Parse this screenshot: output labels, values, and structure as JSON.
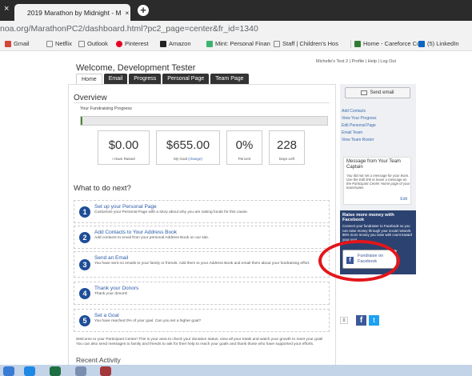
{
  "browser": {
    "tab_close_left": "×",
    "tab_title": "2019 Marathon by Midnight - M  ×",
    "tab_close": "",
    "new_tab": "+",
    "url": "noa.org/MarathonPC2/dashboard.html?pc2_page=center&fr_id=1340",
    "bookmarks": [
      {
        "label": "Gmail",
        "icon_color": "#d44638"
      },
      {
        "label": "Netflix",
        "icon_color": "#888888"
      },
      {
        "label": "Outlook",
        "icon_color": "#888888"
      },
      {
        "label": "Pinterest",
        "icon_color": "#e60023"
      },
      {
        "label": "Amazon",
        "icon_color": "#222222"
      },
      {
        "label": "Mint: Personal Finan",
        "icon_color": "#3cb371"
      },
      {
        "label": "Staff | Children's Hos",
        "icon_color": "#888888"
      },
      {
        "label": "Home - Careforce Co",
        "icon_color": "#2e7d32"
      },
      {
        "label": "(5) LinkedIn",
        "icon_color": "#0a66c2"
      }
    ]
  },
  "page": {
    "welcome": "Welcome, Development Tester",
    "top_links": "Michelle's Test 2  |  Profile  |  Help  |  Log Out",
    "tabs": [
      "Home",
      "Email",
      "Progress",
      "Personal Page",
      "Team Page"
    ],
    "overview_title": "Overview",
    "progress_label": "Your Fundraising Progress",
    "progress_fraction": 0,
    "stats": [
      {
        "value": "$0.00",
        "label": "I Have Raised",
        "link": ""
      },
      {
        "value": "$655.00",
        "label": "My Goal ",
        "link": "(change)"
      },
      {
        "value": "0%",
        "label": "Percent",
        "link": ""
      },
      {
        "value": "228",
        "label": "Days Left",
        "link": ""
      }
    ],
    "next_title": "What to do next?",
    "steps": [
      {
        "num": "1",
        "title": "Set up your Personal Page",
        "desc": "Customize your Personal Page with a story about why you are raising funds for this cause."
      },
      {
        "num": "2",
        "title": "Add Contacts to Your Address Book",
        "desc": "Add contacts to email from your personal Address Book on our site."
      },
      {
        "num": "3",
        "title": "Send an Email",
        "desc": "You have sent no emails to your family or friends. Add them to your Address Book and email them about your fundraising effort."
      },
      {
        "num": "4",
        "title": "Thank your Donors",
        "desc": "Thank your donors!"
      },
      {
        "num": "5",
        "title": "Set a Goal",
        "desc": "You have reached 0% of your goal. Can you set a higher goal?"
      }
    ],
    "welcome_text": "Welcome to your Participant Center! This is your area to check your donation status, view all your totals and watch your growth to meet your goal! You can also send messages to family and friends to ask for their help to reach your goals and thank those who have supported your efforts.",
    "recent_title": "Recent Activity"
  },
  "sidebar": {
    "send_email": "Send email",
    "links": [
      "Add Contacts",
      "View Your Progress",
      "Edit Personal Page",
      "Email Team",
      "View Team Roster"
    ],
    "message_title": "Message from Your Team Captain",
    "message_body": "You did not set a message for your team. Use the Edit link to leave a message on the Participant Center Home page of your teammates.",
    "message_edit": "Edit",
    "fb_title": "Raise more money with Facebook",
    "fb_desc": "Connect your fundraiser to Facebook so you can raise money through your social network. 86% more money you raise with count toward your goal.",
    "fb_button": "Fundraise on Facebook",
    "fb_icon": "f",
    "share_count": "0",
    "share_fb": "f",
    "share_tw": "t"
  },
  "colors": {
    "accent_blue": "#1f4e96",
    "facebook": "#3b5998",
    "annotation_red": "#e3161b"
  }
}
